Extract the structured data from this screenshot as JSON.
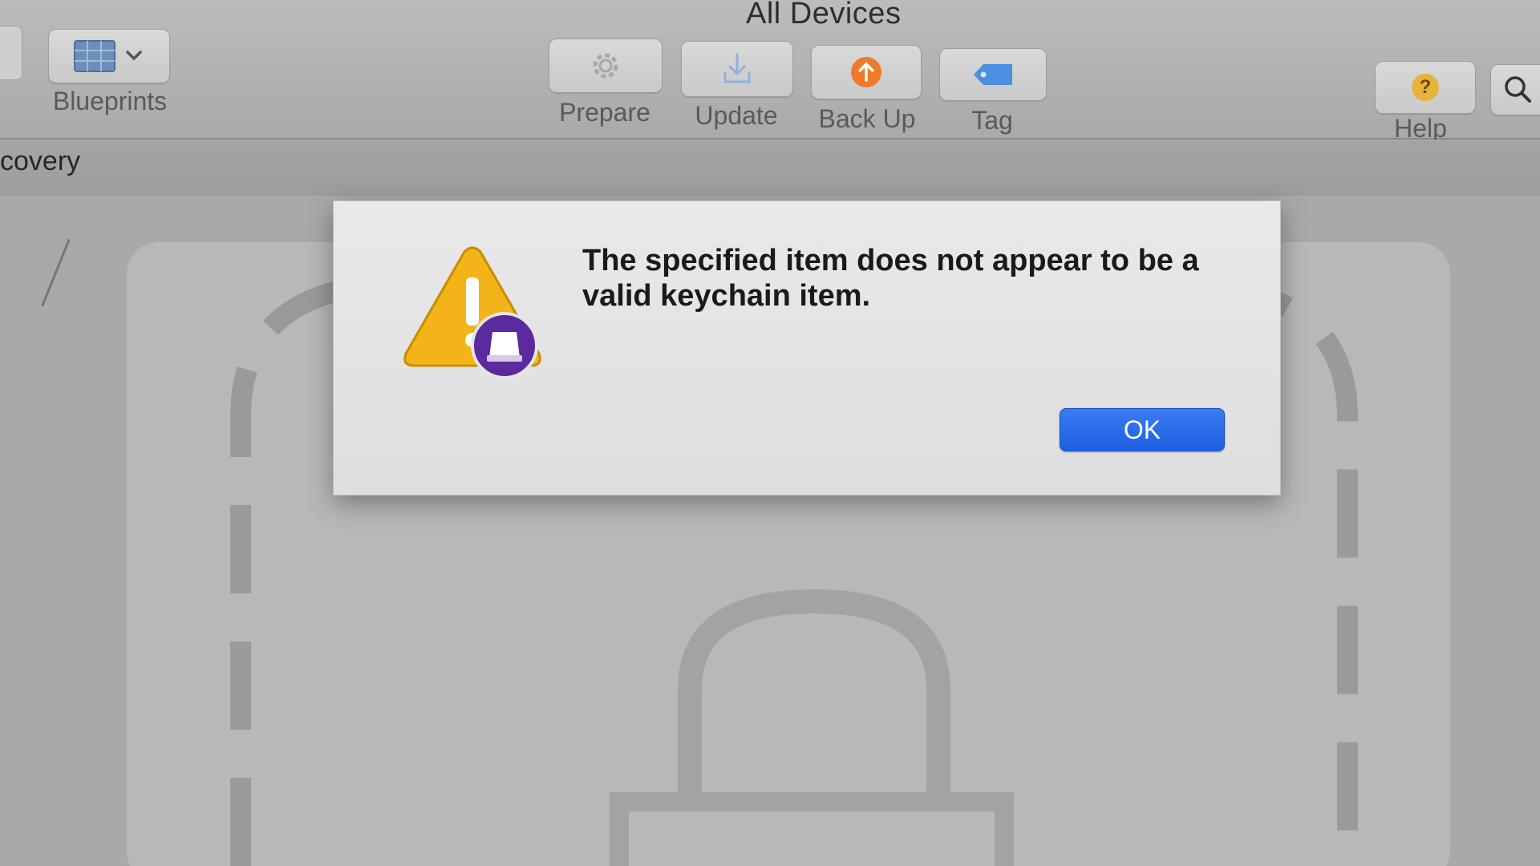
{
  "window": {
    "title": "All Devices"
  },
  "toolbar": {
    "blueprints_label": "Blueprints",
    "prepare_label": "Prepare",
    "update_label": "Update",
    "backup_label": "Back Up",
    "tag_label": "Tag",
    "help_label": "Help",
    "help_glyph": "?"
  },
  "breadcrumb": {
    "text": "covery"
  },
  "alert": {
    "message": "The specified item does not appear to be a valid keychain item.",
    "ok_label": "OK"
  },
  "colors": {
    "accent_blue": "#1d5fe0",
    "warning_yellow": "#f2b418",
    "app_badge_purple": "#5b2a9e",
    "backup_orange": "#f07a2a",
    "tag_blue": "#4a8fe0"
  },
  "icons": {
    "blueprints": "grid-icon",
    "prepare": "gear-icon",
    "update": "download-icon",
    "backup": "upload-arrow-icon",
    "tag": "tag-icon",
    "help": "question-icon",
    "search": "search-icon",
    "alert": "warning-icon"
  }
}
